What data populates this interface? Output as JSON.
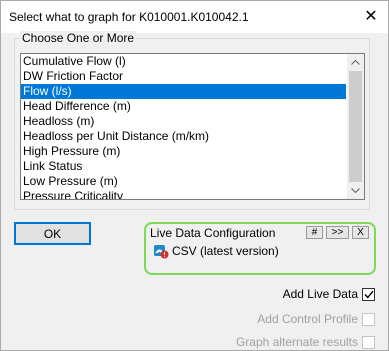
{
  "window": {
    "title": "Select what to graph for K010001.K010042.1",
    "close_glyph": "✕"
  },
  "group": {
    "label": "Choose One or More",
    "items": [
      "Cumulative Flow (l)",
      "DW Friction Factor",
      "Flow (l/s)",
      "Head Difference (m)",
      "Headloss (m)",
      "Headloss per Unit Distance (m/km)",
      "High Pressure (m)",
      "Link Status",
      "Low Pressure (m)",
      "Pressure Criticality"
    ],
    "selected_index": 2
  },
  "ok_label": "OK",
  "live": {
    "title": "Live Data Configuration",
    "buttons": [
      "#",
      ">>",
      "X"
    ],
    "entry": "CSV (latest version)",
    "icon": "csv-source-icon",
    "border_color": "#7ed957"
  },
  "options": {
    "add_live": {
      "label": "Add Live Data",
      "checked": true,
      "enabled": true
    },
    "add_control": {
      "label": "Add Control Profile",
      "checked": false,
      "enabled": false
    },
    "graph_alt": {
      "label": "Graph alternate results",
      "checked": false,
      "enabled": false
    }
  },
  "colors": {
    "selection": "#0078d7",
    "accent": "#0078d7"
  }
}
